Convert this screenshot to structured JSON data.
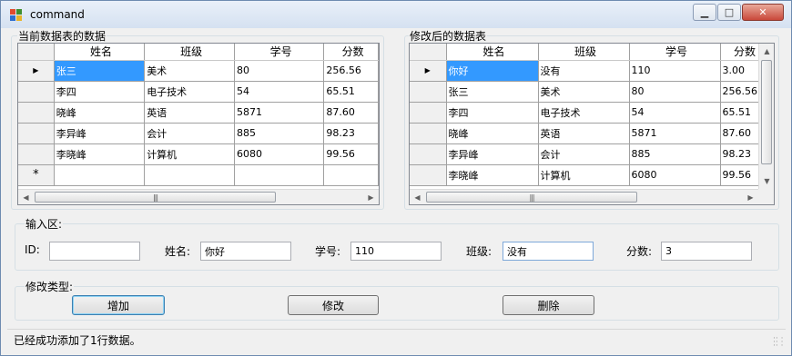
{
  "window": {
    "title": "command"
  },
  "grid_left": {
    "label": "当前数据表的数据",
    "columns": [
      "姓名",
      "班级",
      "学号",
      "分数"
    ],
    "rows": [
      [
        "张三",
        "美术",
        "80",
        "256.56"
      ],
      [
        "李四",
        "电子技术",
        "54",
        "65.51"
      ],
      [
        "晓峰",
        "英语",
        "5871",
        "87.60"
      ],
      [
        "李异峰",
        "会计",
        "885",
        "98.23"
      ],
      [
        "李晓峰",
        "计算机",
        "6080",
        "99.56"
      ]
    ],
    "new_row_marker": "*",
    "current_row_marker": "▶"
  },
  "grid_right": {
    "label": "修改后的数据表",
    "columns": [
      "姓名",
      "班级",
      "学号",
      "分数"
    ],
    "rows": [
      [
        "你好",
        "没有",
        "110",
        "3.00"
      ],
      [
        "张三",
        "美术",
        "80",
        "256.56"
      ],
      [
        "李四",
        "电子技术",
        "54",
        "65.51"
      ],
      [
        "晓峰",
        "英语",
        "5871",
        "87.60"
      ],
      [
        "李异峰",
        "会计",
        "885",
        "98.23"
      ],
      [
        "李晓峰",
        "计算机",
        "6080",
        "99.56"
      ]
    ],
    "current_row_marker": "▶"
  },
  "input_area": {
    "label": "输入区:",
    "id_label": "ID:",
    "id_value": "",
    "name_label": "姓名:",
    "name_value": "你好",
    "number_label": "学号:",
    "number_value": "110",
    "class_label": "班级:",
    "class_value": "没有",
    "score_label": "分数:",
    "score_value": "3"
  },
  "modify_area": {
    "label": "修改类型:",
    "add_label": "增加",
    "modify_label": "修改",
    "delete_label": "删除"
  },
  "status": {
    "text": "已经成功添加了1行数据。"
  }
}
